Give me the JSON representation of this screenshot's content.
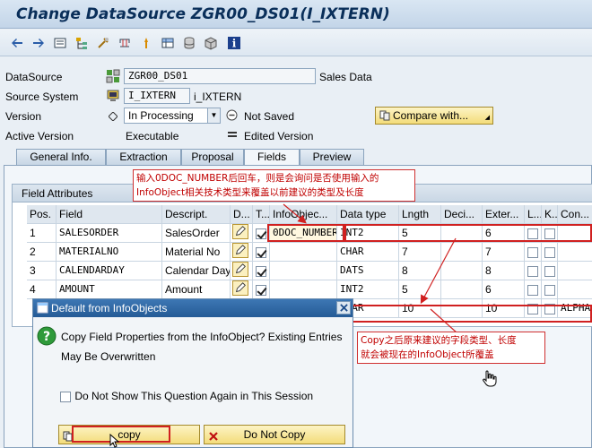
{
  "window": {
    "title": "Change DataSource ZGR00_DS01(I_IXTERN)"
  },
  "toolbar": {
    "icons": [
      "back-icon",
      "forward-icon",
      "display-icon",
      "hierarchy-icon",
      "settings-icon",
      "transport-icon",
      "activate-icon",
      "database-icon",
      "package-icon",
      "info-icon"
    ]
  },
  "header": {
    "datasource_label": "DataSource",
    "datasource_value": "ZGR00_DS01",
    "datasource_desc": "Sales Data",
    "source_system_label": "Source System",
    "source_system_value": "I_IXTERN",
    "source_system_desc": "i_IXTERN",
    "version_label": "Version",
    "version_value": "In Processing",
    "not_saved": "Not Saved",
    "compare_button": "Compare with...",
    "active_version_label": "Active Version",
    "active_version_value": "Executable",
    "edited_version": "Edited Version"
  },
  "tabs": [
    {
      "label": "General Info."
    },
    {
      "label": "Extraction"
    },
    {
      "label": "Proposal"
    },
    {
      "label": "Fields"
    },
    {
      "label": "Preview"
    }
  ],
  "table": {
    "group_title": "Field Attributes",
    "columns": [
      "Pos.",
      "Field",
      "Descript.",
      "D...",
      "T...",
      "InfoObjec...",
      "Data type",
      "Lngth",
      "Deci...",
      "Exter...",
      "L...",
      "K...",
      "Con..."
    ],
    "rows": [
      {
        "pos": "1",
        "field": "SALESORDER",
        "descr": "SalesOrder",
        "infoobject": "0DOC_NUMBER",
        "datatype": "INT2",
        "length": "5",
        "decimals": "",
        "external": "6",
        "conversion": ""
      },
      {
        "pos": "2",
        "field": "MATERIALNO",
        "descr": "Material No",
        "infoobject": "",
        "datatype": "CHAR",
        "length": "7",
        "decimals": "",
        "external": "7",
        "conversion": ""
      },
      {
        "pos": "3",
        "field": "CALENDARDAY",
        "descr": "Calendar Day",
        "infoobject": "",
        "datatype": "DATS",
        "length": "8",
        "decimals": "",
        "external": "8",
        "conversion": ""
      },
      {
        "pos": "4",
        "field": "AMOUNT",
        "descr": "Amount",
        "infoobject": "",
        "datatype": "INT2",
        "length": "5",
        "decimals": "",
        "external": "6",
        "conversion": ""
      }
    ],
    "preview_row": {
      "datatype": "CHAR",
      "length": "10",
      "external": "10",
      "conversion": "ALPHA"
    }
  },
  "dialog": {
    "title": "Default from InfoObjects",
    "message_line1": "Copy Field Properties from the InfoObject? Existing Entries",
    "message_line2": "May Be Overwritten",
    "checkbox_label": "Do Not Show This Question Again in This Session",
    "copy_button": "copy",
    "do_not_copy_button": "Do Not Copy"
  },
  "annotations": {
    "top_line1": "输入0DOC_NUMBER后回车，则是会询问是否使用输入的",
    "top_line2": "InfoObject相关技术类型来覆盖以前建议的类型及长度",
    "bottom_line1": "Copy之后原来建议的字段类型、长度",
    "bottom_line2": "就会被现在的InfoObject所覆盖"
  },
  "colors": {
    "annotation_red": "#d02020",
    "title_blue": "#0a2f5a",
    "dialog_title_bg": "#2f69a6"
  }
}
